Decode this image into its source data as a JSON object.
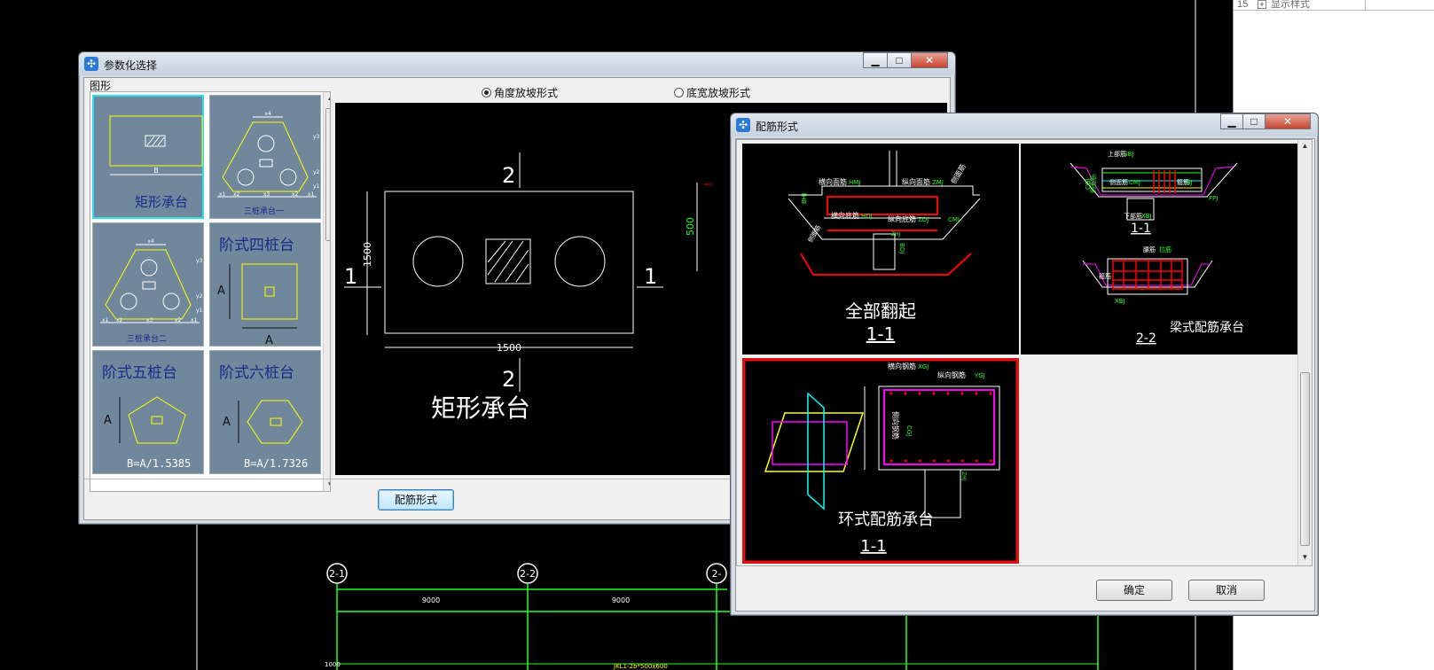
{
  "background": {
    "grid_bubbles": [
      "2-1",
      "2-2",
      "2-"
    ],
    "dimensions": [
      "9000",
      "9000"
    ],
    "bottom_left_label": "1000",
    "bottom_label": "JKL1-2b*500x600"
  },
  "right_panel": {
    "row_number": "15",
    "row_label": "显示样式"
  },
  "param_window": {
    "title": "参数化选择",
    "group_label": "图形",
    "radio_angle": "角度放坡形式",
    "radio_width": "底宽放坡形式",
    "radio_selected": "角度放坡形式",
    "thumbnails": [
      {
        "label": "矩形承台",
        "dim": "B"
      },
      {
        "label": "三桩承台一",
        "dims": [
          "x4",
          "y3",
          "y2",
          "y1",
          "x1",
          "x2",
          "x3",
          "x2",
          "x1"
        ]
      },
      {
        "label": "三桩承台二",
        "dims": [
          "x4",
          "y3",
          "y2",
          "y1",
          "x1",
          "x2",
          "x3",
          "x2",
          "x1"
        ]
      },
      {
        "label": "阶式四桩台",
        "dims": [
          "A",
          "A"
        ]
      },
      {
        "label": "阶式五桩台",
        "formula": "B=A/1.5385",
        "dim": "A"
      },
      {
        "label": "阶式六桩台",
        "formula": "B=A/1.7326",
        "dim": "A"
      }
    ],
    "preview": {
      "title": "矩形承台",
      "dim_width": "1500",
      "dim_height": "1500",
      "section_top": "2",
      "section_bottom": "2",
      "section_left": "1",
      "section_right": "1",
      "right_partial_dim": "500"
    },
    "button_rebar": "配筋形式",
    "controls": [
      "▁",
      "□",
      "✕"
    ]
  },
  "rebar_window": {
    "title": "配筋形式",
    "panels": [
      {
        "title": "全部翻起",
        "section": "1-1",
        "labels": [
          "横向面筋",
          "HMJ",
          "纵向面筋",
          "ZMJ",
          "横向底筋",
          "HDJ",
          "纵向底筋",
          "ZDJ",
          "侧面筋",
          "CMJ",
          "侧面筋",
          "BHJ",
          "BDJ",
          "ZHJ"
        ]
      },
      {
        "title": "梁式配筋承台",
        "sections": [
          "1-1",
          "2-2"
        ],
        "labels": [
          "上部筋",
          "SBJ",
          "侧面筋",
          "CMJ",
          "下部筋",
          "XBJ",
          "箍筋",
          "GJ",
          "侧面筋",
          "CGJ",
          "FPJ",
          "XBJ",
          "腰筋",
          "拉筋"
        ]
      },
      {
        "title": "环式配筋承台",
        "section": "1-1",
        "labels": [
          "横向钢筋",
          "XGJ",
          "纵向钢筋",
          "YGJ",
          "侧向钢筋",
          "CGJ",
          "ZHJ"
        ]
      }
    ],
    "button_ok": "确定",
    "button_cancel": "取消",
    "controls": [
      "▁",
      "□",
      "✕"
    ]
  }
}
